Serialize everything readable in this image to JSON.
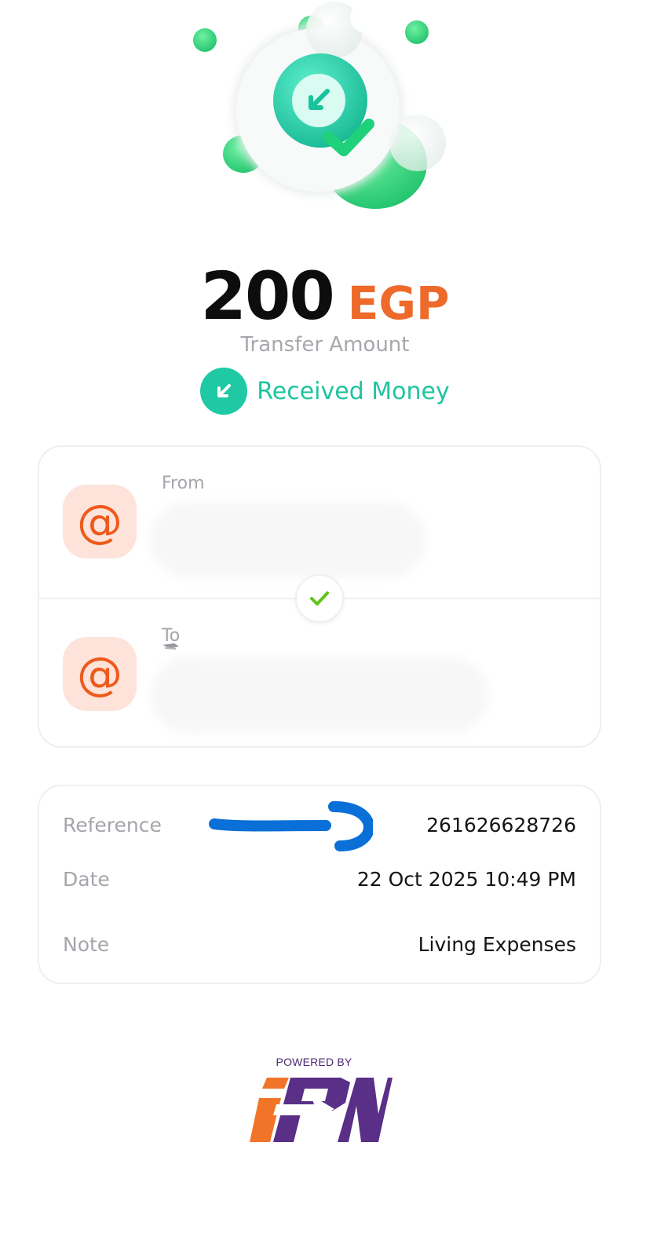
{
  "transfer": {
    "amount": "200",
    "currency": "EGP",
    "amount_caption": "Transfer Amount",
    "status": "Received Money"
  },
  "parties": {
    "from_label": "From",
    "to_label": "To"
  },
  "details": {
    "reference_label": "Reference",
    "reference_value": "261626628726",
    "date_label": "Date",
    "date_value": "22 Oct 2025 10:49 PM",
    "note_label": "Note",
    "note_value": "Living Expenses"
  },
  "footer": {
    "powered_by": "POWERED BY",
    "logo_text": "IPN"
  },
  "icons": {
    "hero": "received-money-illustration",
    "status": "arrow-down-left-icon",
    "avatar": "at-sign-icon",
    "transfer_check": "check-icon",
    "annotation": "blue-arrow-annotation"
  },
  "colors": {
    "accent_green": "#1ec9a3",
    "currency_orange": "#ee6a2b",
    "avatar_bg": "#fde3da",
    "avatar_icon": "#ee5a1c",
    "annotation_blue": "#0a6fd6",
    "logo_purple": "#5a2f87",
    "logo_orange": "#f27428"
  }
}
